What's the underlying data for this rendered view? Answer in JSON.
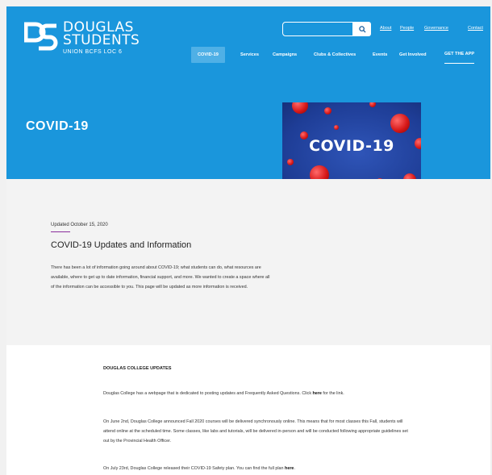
{
  "logo": {
    "line1": "DOUGLAS",
    "line2": "STUDENTS",
    "line3": "UNION BCFS LOC 6"
  },
  "search": {
    "placeholder": ""
  },
  "utility_nav": [
    "About",
    "People",
    "Governance",
    "Contact"
  ],
  "main_nav": [
    "COVID-19",
    "Services",
    "Campaigns",
    "Clubs & Collectives",
    "Events",
    "Get Involved",
    "GET THE APP"
  ],
  "page_title": "COVID-19",
  "hero_image_text": "COVID-19",
  "colors": {
    "brand_blue": "#1a96dc",
    "active_nav": "#4fb0e6",
    "accent_rule": "#8a2f9c"
  },
  "info": {
    "updated": "Updated October 15, 2020",
    "heading": "COVID-19 Updates and Information",
    "body": "There has been a lot of information going around about COVID-19; what students can do, what resources are available, where to get up to date information, financial support, and more. We wanted to create a space where all of the information can be accessible to you. This page will be updated as more information is received."
  },
  "college": {
    "heading": "DOUGLAS COLLEGE UPDATES",
    "p1_pre": "Douglas College has a webpage that is dedicated to posting updates and Frequently Asked Questions. Click ",
    "p1_link": "here",
    "p1_post": " for the link.",
    "p2": "On June 2nd, Douglas College announced Fall 2020 courses will be delivered synchronously online. This means that for most classes this Fall, students will attend online at the scheduled time. Some classes, like labs and tutorials, will be delivered in-person and will be conducted following appropriate guidelines set out by the Provincial Health Officer.",
    "p3_pre": "On July 23rd, Douglas College released their COVID-19 Safety plan. You can find the full plan ",
    "p3_link": "here",
    "p3_post": "."
  }
}
